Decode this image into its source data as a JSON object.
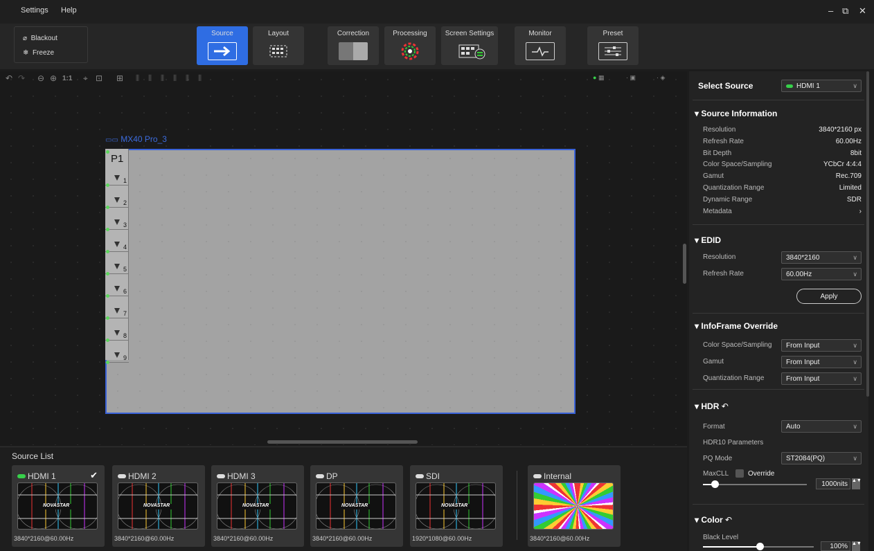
{
  "menu": {
    "settings": "Settings",
    "help": "Help"
  },
  "window": {
    "min": "–",
    "restore": "⧉",
    "close": "✕"
  },
  "quick": {
    "blackout": "Blackout",
    "freeze": "Freeze"
  },
  "tabs": [
    {
      "label": "Source",
      "active": true
    },
    {
      "label": "Layout"
    },
    {
      "label": "Correction"
    },
    {
      "label": "Processing"
    },
    {
      "label": "Screen Settings"
    },
    {
      "label": "Monitor"
    },
    {
      "label": "Preset"
    }
  ],
  "canvas": {
    "device_label": "MX40 Pro_3",
    "port": "P1",
    "segments": [
      "1",
      "2",
      "3",
      "4",
      "5",
      "6",
      "7",
      "8",
      "9"
    ],
    "zoom_label": "1:1"
  },
  "source_list": {
    "title": "Source List",
    "cards": [
      {
        "name": "HDMI 1",
        "res": "3840*2160@60.00Hz",
        "active": true,
        "checked": "✔"
      },
      {
        "name": "HDMI 2",
        "res": "3840*2160@60.00Hz"
      },
      {
        "name": "HDMI 3",
        "res": "3840*2160@60.00Hz"
      },
      {
        "name": "DP",
        "res": "3840*2160@60.00Hz"
      },
      {
        "name": "SDI",
        "res": "1920*1080@60.00Hz"
      },
      {
        "name": "Internal",
        "res": "3840*2160@60.00Hz"
      }
    ]
  },
  "thumb_logo": "NOVASTAR",
  "right": {
    "select_source": {
      "label": "Select Source",
      "value": "HDMI 1"
    },
    "source_info": {
      "title": "Source Information",
      "rows": [
        [
          "Resolution",
          "3840*2160 px"
        ],
        [
          "Refresh Rate",
          "60.00Hz"
        ],
        [
          "Bit Depth",
          "8bit"
        ],
        [
          "Color Space/Sampling",
          "YCbCr 4:4:4"
        ],
        [
          "Gamut",
          "Rec.709"
        ],
        [
          "Quantization Range",
          "Limited"
        ],
        [
          "Dynamic Range",
          "SDR"
        ],
        [
          "Metadata",
          "›"
        ]
      ]
    },
    "edid": {
      "title": "EDID",
      "resolution_label": "Resolution",
      "resolution": "3840*2160",
      "refresh_label": "Refresh Rate",
      "refresh": "60.00Hz",
      "apply": "Apply"
    },
    "infoframe": {
      "title": "InfoFrame Override",
      "rows": [
        [
          "Color Space/Sampling",
          "From Input"
        ],
        [
          "Gamut",
          "From Input"
        ],
        [
          "Quantization Range",
          "From Input"
        ]
      ]
    },
    "hdr": {
      "title": "HDR",
      "format_label": "Format",
      "format": "Auto",
      "params": "HDR10 Parameters",
      "pq_label": "PQ Mode",
      "pq": "ST2084(PQ)",
      "maxcll": "MaxCLL",
      "override": "Override",
      "nits": "1000nits"
    },
    "color": {
      "title": "Color",
      "black_label": "Black Level",
      "black": "100%"
    }
  }
}
